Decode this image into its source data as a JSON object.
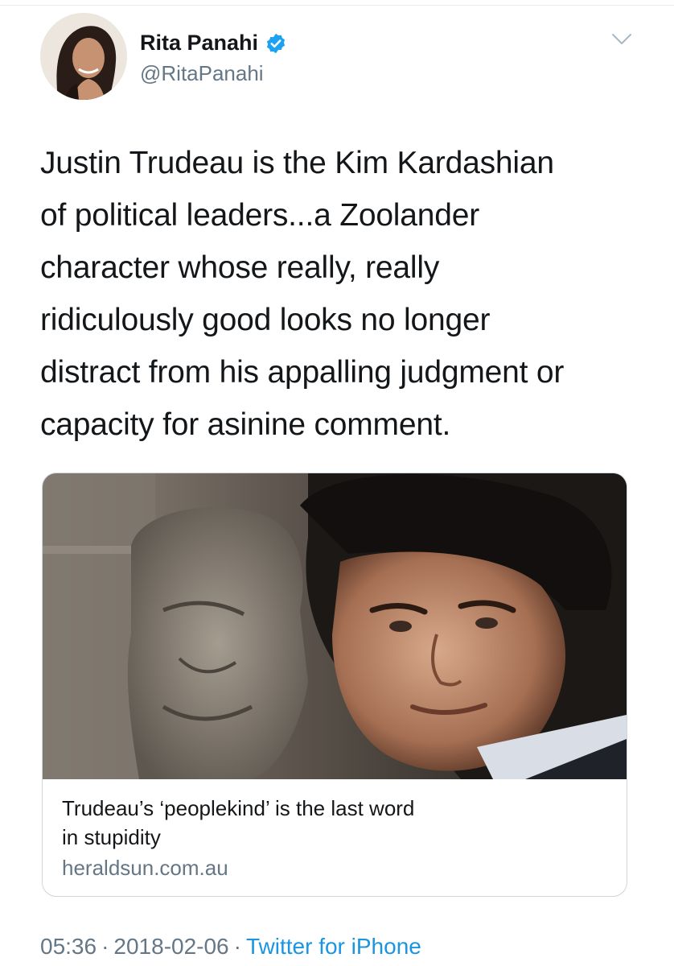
{
  "tweet": {
    "author_name": "Rita Panahi",
    "author_handle": "@RitaPanahi",
    "text_lines": [
      "Justin Trudeau is the Kim Kardashian",
      "of political leaders...a Zoolander",
      "character whose really, really",
      "ridiculously good looks no longer",
      "distract from his appalling judgment or",
      "capacity for asinine comment."
    ],
    "card": {
      "title_lines": [
        "Trudeau’s ‘peoplekind’ is the last word",
        "in stupidity"
      ],
      "domain": "heraldsun.com.au"
    },
    "time": "05:36",
    "date": "2018-02-06",
    "separator": "·",
    "source": "Twitter for iPhone"
  },
  "icons": {
    "verified": "verified-badge-icon",
    "menu": "chevron-down-icon"
  },
  "colors": {
    "text": "#14171a",
    "secondary": "#657786",
    "link": "#1b95e0",
    "verified": "#1da1f2"
  }
}
